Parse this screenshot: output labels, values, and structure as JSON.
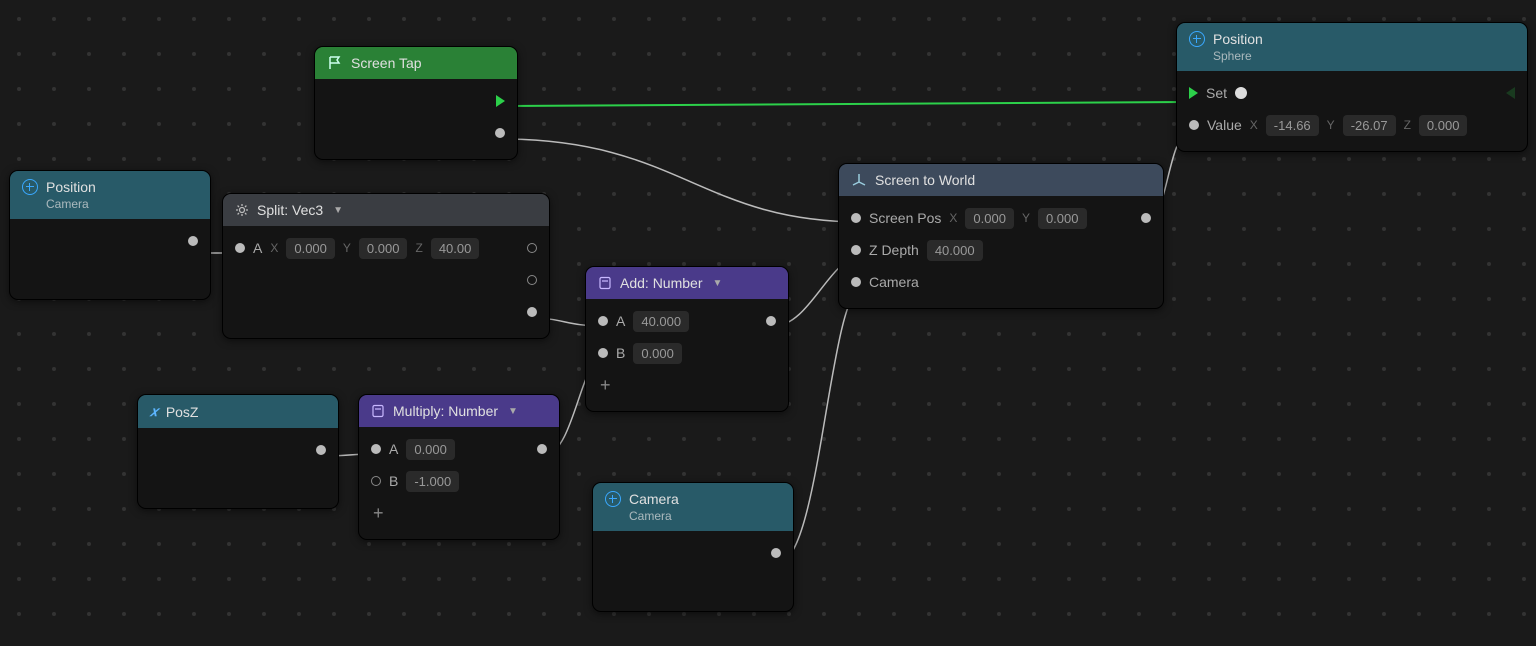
{
  "nodes": {
    "position_camera": {
      "title": "Position",
      "subtitle": "Camera"
    },
    "screen_tap": {
      "title": "Screen Tap"
    },
    "split_vec3": {
      "title": "Split: Vec3",
      "axis_a": "A",
      "x_lbl": "X",
      "y_lbl": "Y",
      "z_lbl": "Z",
      "x": "0.000",
      "y": "0.000",
      "z": "40.00"
    },
    "posz": {
      "title": "PosZ"
    },
    "multiply": {
      "title": "Multiply: Number",
      "a_lbl": "A",
      "b_lbl": "B",
      "a": "0.000",
      "b": "-1.000"
    },
    "add": {
      "title": "Add: Number",
      "a_lbl": "A",
      "b_lbl": "B",
      "a": "40.000",
      "b": "0.000"
    },
    "camera": {
      "title": "Camera",
      "subtitle": "Camera"
    },
    "screen_to_world": {
      "title": "Screen to World",
      "screenpos_lbl": "Screen Pos",
      "x_lbl": "X",
      "y_lbl": "Y",
      "x": "0.000",
      "y": "0.000",
      "zdepth_lbl": "Z Depth",
      "zdepth": "40.000",
      "camera_lbl": "Camera"
    },
    "position_sphere": {
      "title": "Position",
      "subtitle": "Sphere",
      "set_lbl": "Set",
      "value_lbl": "Value",
      "vx_lbl": "X",
      "vy_lbl": "Y",
      "vz_lbl": "Z",
      "vx": "-14.66",
      "vy": "-26.07",
      "vz": "0.000"
    }
  }
}
